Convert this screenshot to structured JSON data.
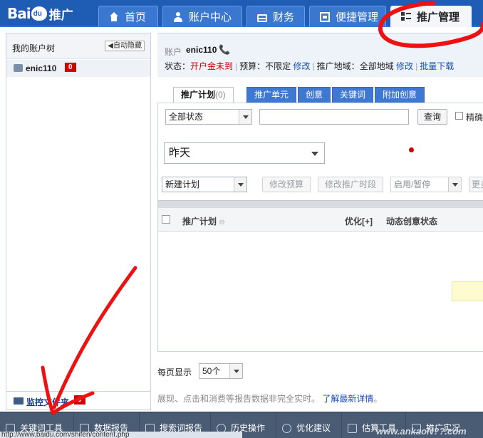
{
  "nav": {
    "logo_text": "Bai",
    "logo_paw": "du",
    "logo_suffix": "推广",
    "tabs": [
      {
        "label": "首页",
        "icon": "home-icon"
      },
      {
        "label": "账户中心",
        "icon": "user-icon"
      },
      {
        "label": "财务",
        "icon": "card-icon"
      },
      {
        "label": "便捷管理",
        "icon": "window-icon"
      },
      {
        "label": "推广管理",
        "icon": "grid-icon",
        "active": true
      }
    ]
  },
  "sidebar": {
    "title": "我的账户树",
    "hide_button": "自动隐藏",
    "account": {
      "name": "enic110",
      "badge": "0"
    },
    "footer": {
      "label": "监控文件夹",
      "badge": "0"
    }
  },
  "account_info": {
    "account_label": "账户",
    "account_name": "enic110",
    "status_label": "状态：",
    "status_value": "开户金未到",
    "budget_label": "预算：",
    "budget_value": "不限定",
    "budget_edit": "修改",
    "region_label": "推广地域：",
    "region_value": "全部地域",
    "region_edit": "修改",
    "batch_download": "批量下载"
  },
  "subtabs": [
    {
      "label": "推广计划",
      "count": "(0)",
      "active": true
    },
    {
      "label": "推广单元"
    },
    {
      "label": "创意"
    },
    {
      "label": "关键词"
    },
    {
      "label": "附加创意"
    }
  ],
  "filters": {
    "status_select": "全部状态",
    "search_value": "",
    "query_button": "查询",
    "exact_label": "精确",
    "date_select": "昨天"
  },
  "toolbar": {
    "new_plan": "新建计划",
    "edit_budget": "修改预算",
    "edit_time": "修改推广时段",
    "enable_pause": "启用/暂停",
    "more": "更多"
  },
  "table": {
    "col_plan": "推广计划",
    "col_plan_sort": "⊖",
    "col_optimize": "优化[+]",
    "col_dynamic": "动态创意状态"
  },
  "pagination": {
    "per_page_label": "每页显示",
    "per_page_value": "50个"
  },
  "notice": {
    "text": "展现、点击和消费等报告数据非完全实时。",
    "link": "了解最新详情"
  },
  "bottom_bar": [
    {
      "label": "关键词工具"
    },
    {
      "label": "数据报告"
    },
    {
      "label": "搜索词报告"
    },
    {
      "label": "历史操作"
    },
    {
      "label": "优化建议"
    },
    {
      "label": "估算工具"
    },
    {
      "label": "推广实况"
    }
  ],
  "status_url": "http://www.baidu.com/shifen/content.php",
  "watermark": "www.ankaoN??.com",
  "colors": {
    "nav_bg": "#1f5cb4",
    "tab_bg": "#3a77d0",
    "alert_red": "#d30000",
    "link_blue": "#1a4fb8",
    "bottom_bg": "#4a5b74"
  }
}
